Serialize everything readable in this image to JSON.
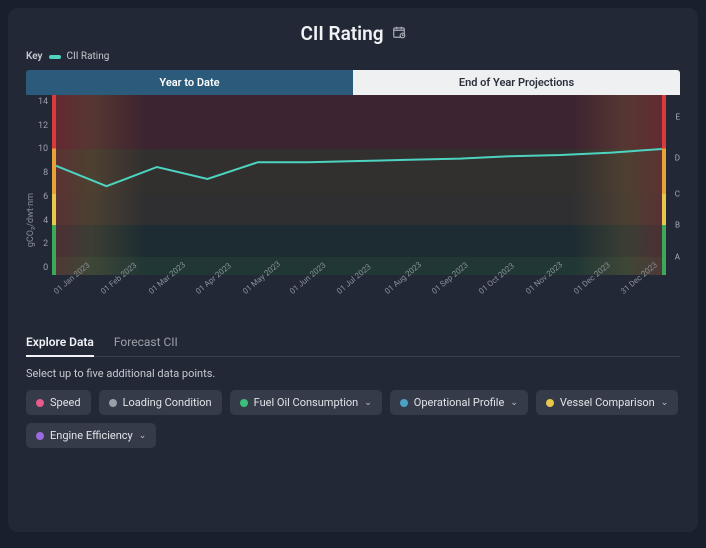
{
  "header": {
    "title": "CII Rating",
    "key_label": "Key",
    "series_name": "CII Rating"
  },
  "top_tabs": {
    "ytd": "Year to Date",
    "eoy": "End of Year Projections"
  },
  "chart_data": {
    "type": "line",
    "ylabel": "gCO₂/dwt·nm",
    "ylim": [
      0,
      15
    ],
    "yticks": [
      0,
      2,
      4,
      6,
      8,
      10,
      12,
      14
    ],
    "grade_bands": [
      "E",
      "D",
      "C",
      "B",
      "A"
    ],
    "categories": [
      "01 Jan 2023",
      "01 Feb 2023",
      "01 Mar 2023",
      "01 Apr 2023",
      "01 May 2023",
      "01 Jun 2023",
      "01 Jul 2023",
      "01 Aug 2023",
      "01 Sep 2023",
      "01 Oct 2023",
      "01 Nov 2023",
      "01 Dec 2023",
      "31 Dec 2023"
    ],
    "series": [
      {
        "name": "CII Rating",
        "color": "#4dd4c0",
        "values": [
          9.1,
          7.4,
          9.0,
          8.0,
          9.4,
          9.4,
          9.5,
          9.6,
          9.7,
          9.9,
          10.0,
          10.2,
          10.5
        ]
      }
    ]
  },
  "bottom_tabs": {
    "explore": "Explore Data",
    "forecast": "Forecast CII"
  },
  "instruction": "Select up to five additional data points.",
  "chips": [
    {
      "label": "Speed",
      "color": "#e85a8a",
      "dropdown": false
    },
    {
      "label": "Loading Condition",
      "color": "#9aa0a8",
      "dropdown": false
    },
    {
      "label": "Fuel Oil Consumption",
      "color": "#3bbf7a",
      "dropdown": true
    },
    {
      "label": "Operational Profile",
      "color": "#4aa3c4",
      "dropdown": true
    },
    {
      "label": "Vessel Comparison",
      "color": "#e8c84a",
      "dropdown": true
    },
    {
      "label": "Engine Efficiency",
      "color": "#9a6ae0",
      "dropdown": true
    }
  ]
}
